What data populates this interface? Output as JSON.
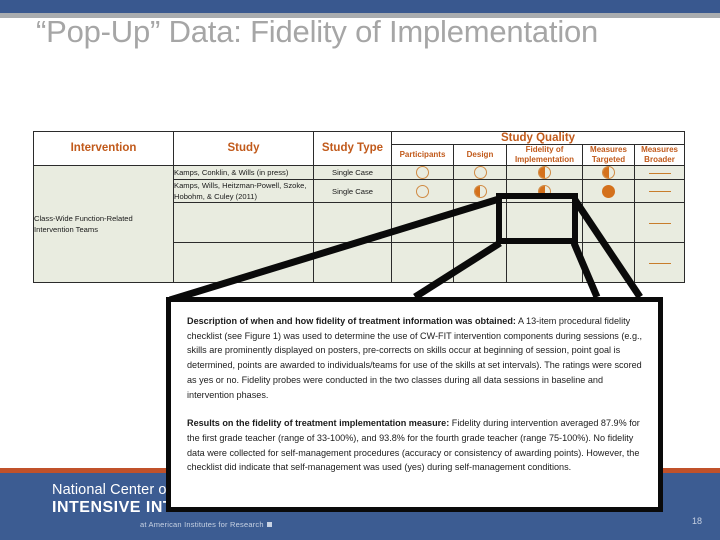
{
  "slide": {
    "title": "“Pop-Up” Data: Fidelity of Implementation",
    "page_number": "18",
    "accent_blue": "#3c5c92",
    "accent_orange": "#c0512a",
    "header_text_color": "#c15a1b",
    "rating_color": "#d4711c"
  },
  "table": {
    "group_header": "Study Quality",
    "columns": [
      {
        "key": "intervention",
        "label": "Intervention"
      },
      {
        "key": "study",
        "label": "Study"
      },
      {
        "key": "study_type",
        "label": "Study Type"
      },
      {
        "key": "participants",
        "label": "Participants"
      },
      {
        "key": "design",
        "label": "Design"
      },
      {
        "key": "fidelity",
        "label": "Fidelity of Implementation"
      },
      {
        "key": "measures_targeted",
        "label": "Measures Targeted"
      },
      {
        "key": "measures_broader",
        "label": "Measures Broader"
      }
    ],
    "intervention_label": "Class-Wide Function-Related Intervention Teams",
    "rows": [
      {
        "study": "Kamps, Conklin, & Wills (in press)",
        "study_type": "Single Case",
        "participants": "empty-circle",
        "design": "empty-circle",
        "fidelity": "half-circle",
        "measures_targeted": "half-circle",
        "measures_broader": "dash"
      },
      {
        "study": "Kamps, Wills, Heitzman-Powell, Szoke, Hobohm, & Culey (2011)",
        "study_type": "Single Case",
        "participants": "empty-circle",
        "design": "half-circle",
        "fidelity": "half-circle",
        "measures_targeted": "full-circle",
        "measures_broader": "dash"
      },
      {
        "study": "",
        "study_type": "",
        "participants": "",
        "design": "",
        "fidelity": "",
        "measures_targeted": "",
        "measures_broader": "dash"
      },
      {
        "study": "",
        "study_type": "",
        "participants": "",
        "design": "",
        "fidelity": "",
        "measures_targeted": "",
        "measures_broader": "dash"
      }
    ]
  },
  "popup": {
    "paragraph_1_lead": "Description of when and how fidelity of treatment information was obtained:",
    "paragraph_1_body": " A 13-item procedural fidelity checklist (see Figure 1) was used to determine the use of CW-FIT intervention components during sessions (e.g., skills are prominently displayed on posters, pre-corrects on skills occur at beginning of session, point goal is determined, points are awarded to individuals/teams for use of the skills at set intervals).  The ratings were scored as yes or no. Fidelity probes were conducted in the two classes during all data sessions in baseline and intervention phases.",
    "paragraph_2_lead": "Results on the fidelity of treatment implementation measure:",
    "paragraph_2_body": " Fidelity during intervention averaged 87.9% for the first grade teacher (range of 33-100%), and 93.8% for the fourth grade teacher (range 75-100%).  No fidelity data were collected for self-management procedures (accuracy or consistency of awarding points). However, the checklist did indicate that self-management was used (yes) during self-management conditions."
  },
  "footer": {
    "logo_line1": "National Center on",
    "logo_line2": "INTENSIVE INTERVENTION",
    "logo_sub": "at American Institutes for Research"
  }
}
